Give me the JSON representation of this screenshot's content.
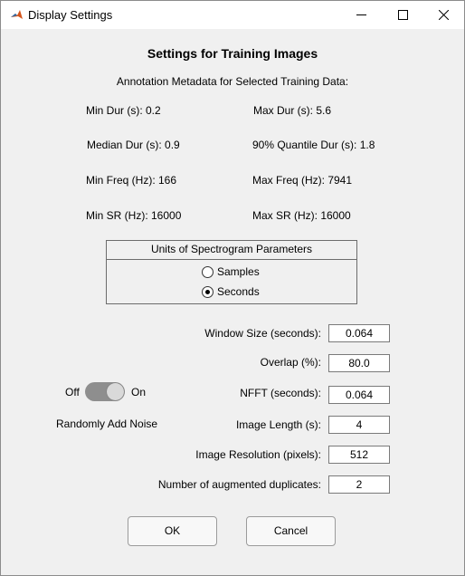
{
  "window": {
    "title": "Display Settings"
  },
  "heading": "Settings for Training Images",
  "subheading": "Annotation Metadata for Selected Training Data:",
  "metadata": [
    {
      "label": "Min Dur (s): 0.2"
    },
    {
      "label": "Max Dur (s): 5.6"
    },
    {
      "label": "Median Dur (s): 0.9"
    },
    {
      "label": "90% Quantile Dur (s): 1.8"
    },
    {
      "label": "Min Freq (Hz): 166"
    },
    {
      "label": "Max Freq (Hz): 7941"
    },
    {
      "label": "Min SR (Hz): 16000"
    },
    {
      "label": "Max SR (Hz): 16000"
    }
  ],
  "units_panel": {
    "title": "Units of Spectrogram Parameters",
    "options": [
      "Samples",
      "Seconds"
    ],
    "selected": "Seconds"
  },
  "params": {
    "window_size": {
      "label": "Window Size (seconds):",
      "value": "0.064"
    },
    "overlap": {
      "label": "Overlap (%):",
      "value": "80.0"
    },
    "nfft": {
      "label": "NFFT (seconds):",
      "value": "0.064"
    },
    "image_length": {
      "label": "Image Length (s):",
      "value": "4"
    },
    "image_resolution": {
      "label": "Image Resolution (pixels):",
      "value": "512"
    },
    "augmented": {
      "label": "Number of augmented duplicates:",
      "value": "2"
    }
  },
  "noise_toggle": {
    "off_label": "Off",
    "on_label": "On",
    "state": "on",
    "caption": "Randomly Add Noise"
  },
  "buttons": {
    "ok": "OK",
    "cancel": "Cancel"
  },
  "colors": {
    "window_bg": "#f0f0f0",
    "titlebar_bg": "#ffffff",
    "toggle_on": "#8e8e8e"
  }
}
